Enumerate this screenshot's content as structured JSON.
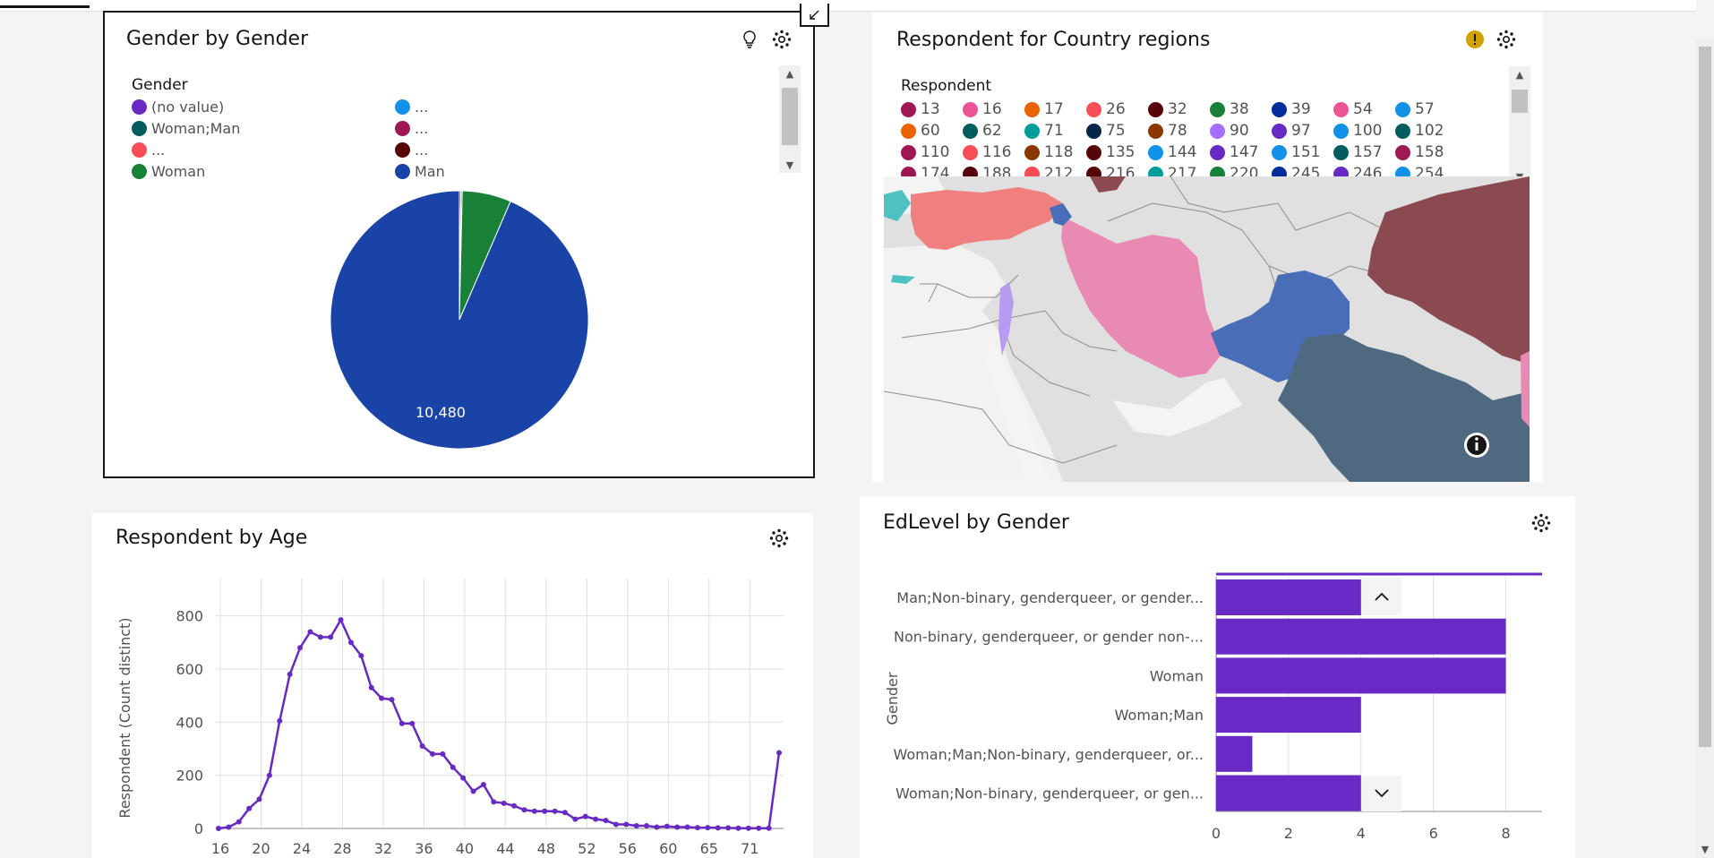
{
  "pie_card": {
    "title": "Gender by Gender",
    "legend_title": "Gender",
    "legend": [
      {
        "label": "(no value)",
        "color": "#6929c4"
      },
      {
        "label": "...",
        "color": "#1192e8"
      },
      {
        "label": "Woman;Man",
        "color": "#005d5d"
      },
      {
        "label": "...",
        "color": "#9f1853"
      },
      {
        "label": "...",
        "color": "#fa4d56"
      },
      {
        "label": "...",
        "color": "#570408"
      },
      {
        "label": "Woman",
        "color": "#198038"
      },
      {
        "label": "Man",
        "color": "#1a43a8"
      }
    ],
    "center_label": "10,480",
    "slices": [
      {
        "name": "Man",
        "value": 10480,
        "color": "#1a43a8"
      },
      {
        "name": "...",
        "value": 20,
        "color": "#570408"
      },
      {
        "name": "...",
        "value": 20,
        "color": "#fa4d56"
      },
      {
        "name": "Woman",
        "value": 688,
        "color": "#198038"
      }
    ]
  },
  "map_card": {
    "title": "Respondent for Country regions",
    "legend_title": "Respondent",
    "legend": [
      {
        "label": "13",
        "color": "#9f1853"
      },
      {
        "label": "16",
        "color": "#ee5396"
      },
      {
        "label": "17",
        "color": "#eb6200"
      },
      {
        "label": "26",
        "color": "#fa4d56"
      },
      {
        "label": "32",
        "color": "#570408"
      },
      {
        "label": "38",
        "color": "#198038"
      },
      {
        "label": "39",
        "color": "#002d9c"
      },
      {
        "label": "54",
        "color": "#ee5396"
      },
      {
        "label": "57",
        "color": "#1192e8"
      },
      {
        "label": "60",
        "color": "#eb6200"
      },
      {
        "label": "62",
        "color": "#005d5d"
      },
      {
        "label": "71",
        "color": "#009d9a"
      },
      {
        "label": "75",
        "color": "#012749"
      },
      {
        "label": "78",
        "color": "#8a3800"
      },
      {
        "label": "90",
        "color": "#a56eff"
      },
      {
        "label": "97",
        "color": "#6929c4"
      },
      {
        "label": "100",
        "color": "#1192e8"
      },
      {
        "label": "102",
        "color": "#005d5d"
      },
      {
        "label": "110",
        "color": "#9f1853"
      },
      {
        "label": "116",
        "color": "#fa4d56"
      },
      {
        "label": "118",
        "color": "#8a3800"
      },
      {
        "label": "135",
        "color": "#570408"
      },
      {
        "label": "144",
        "color": "#1192e8"
      },
      {
        "label": "147",
        "color": "#6929c4"
      },
      {
        "label": "151",
        "color": "#1192e8"
      },
      {
        "label": "157",
        "color": "#005d5d"
      },
      {
        "label": "158",
        "color": "#9f1853"
      },
      {
        "label": "174",
        "color": "#9f1853"
      },
      {
        "label": "188",
        "color": "#570408"
      },
      {
        "label": "212",
        "color": "#fa4d56"
      },
      {
        "label": "216",
        "color": "#570408"
      },
      {
        "label": "217",
        "color": "#009d9a"
      },
      {
        "label": "220",
        "color": "#198038"
      },
      {
        "label": "245",
        "color": "#002d9c"
      },
      {
        "label": "246",
        "color": "#6929c4"
      },
      {
        "label": "254",
        "color": "#1192e8"
      }
    ]
  },
  "line_card": {
    "title": "Respondent by Age",
    "chart_data": {
      "type": "line",
      "title": "Respondent by Age",
      "xlabel": "",
      "ylabel": "Respondent (Count distinct)",
      "ylim": [
        0,
        900
      ],
      "yticks": [
        "0",
        "200",
        "400",
        "600",
        "800"
      ],
      "xticks": [
        "16",
        "20",
        "24",
        "28",
        "32",
        "36",
        "40",
        "44",
        "48",
        "52",
        "56",
        "60",
        "65",
        "71"
      ],
      "color": "#6929c4",
      "grid": true,
      "values": [
        0,
        5,
        25,
        75,
        110,
        200,
        405,
        580,
        680,
        740,
        720,
        720,
        785,
        700,
        650,
        530,
        490,
        485,
        395,
        395,
        310,
        280,
        280,
        230,
        190,
        140,
        165,
        100,
        95,
        85,
        70,
        65,
        65,
        65,
        60,
        35,
        45,
        35,
        30,
        15,
        15,
        10,
        10,
        5,
        8,
        5,
        5,
        3,
        3,
        2,
        2,
        1,
        1,
        1,
        1,
        285
      ]
    }
  },
  "bar_card": {
    "title": "EdLevel by Gender",
    "chart_data": {
      "type": "bar",
      "orientation": "horizontal",
      "title": "EdLevel by Gender",
      "ylabel": "Gender",
      "xlabel": "",
      "xlim": [
        0,
        9
      ],
      "xticks": [
        "0",
        "2",
        "4",
        "6",
        "8"
      ],
      "color": "#6929c4",
      "categories": [
        "Man;Non-binary, genderqueer, or gender...",
        "Non-binary, genderqueer, or gender non-...",
        "Woman",
        "Woman;Man",
        "Woman;Man;Non-binary, genderqueer, or...",
        "Woman;Non-binary, genderqueer, or gen..."
      ],
      "values": [
        4,
        8,
        8,
        4,
        1,
        4
      ]
    }
  }
}
